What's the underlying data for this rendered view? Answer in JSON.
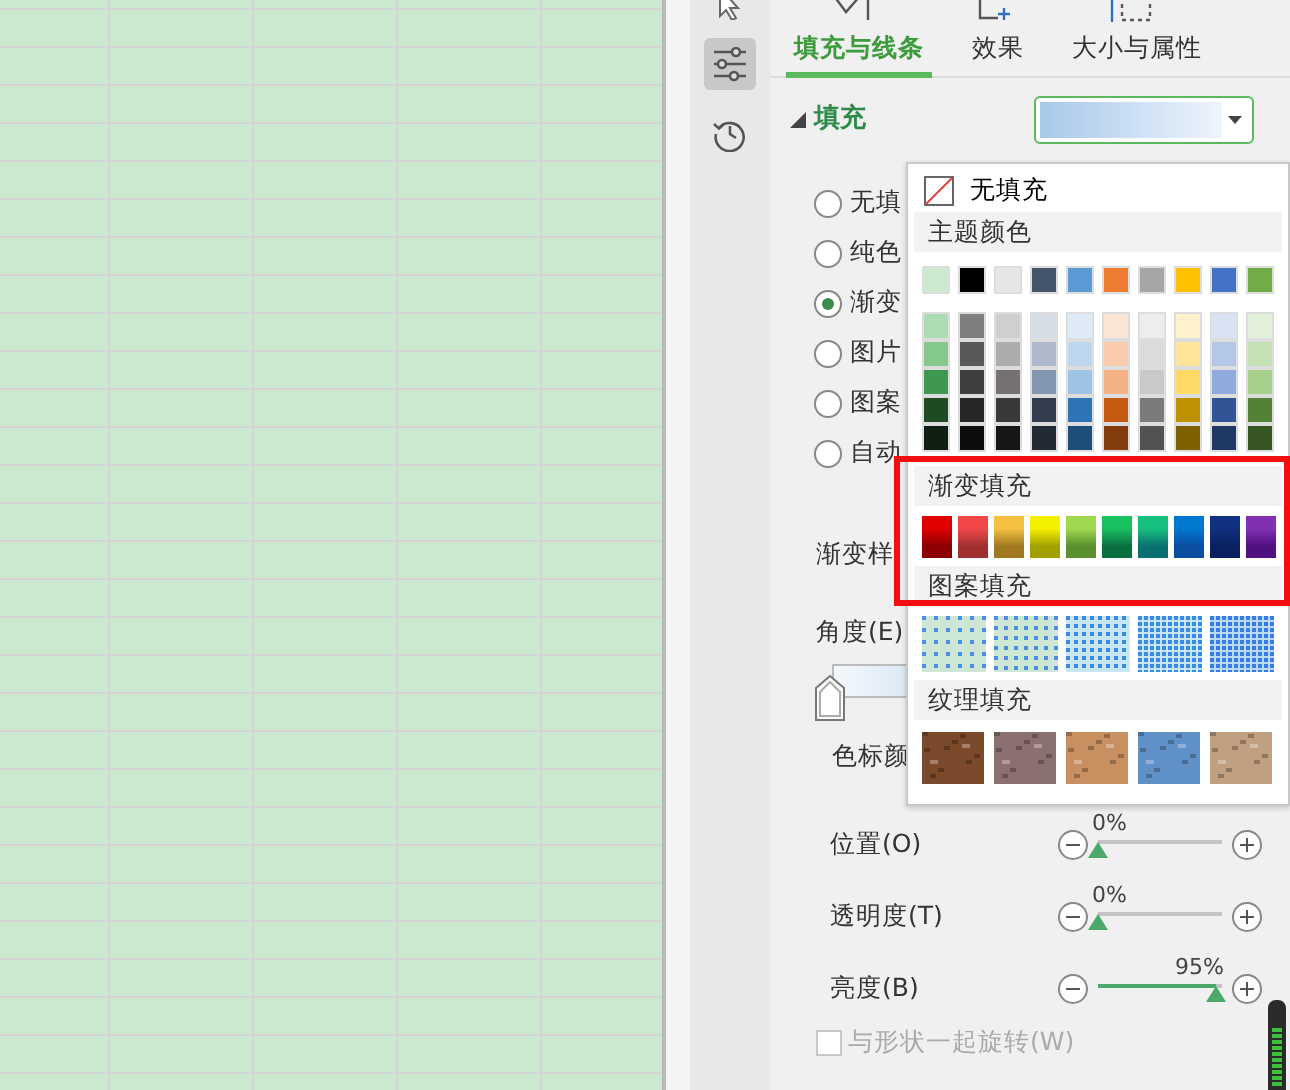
{
  "sidebar": {
    "items": [
      {
        "kind": "pointer",
        "selected": false
      },
      {
        "kind": "properties",
        "selected": true
      },
      {
        "kind": "history",
        "selected": false
      }
    ]
  },
  "tabs": [
    {
      "kind": "fill",
      "label": "填充与线条",
      "selected": true
    },
    {
      "kind": "effect",
      "label": "效果",
      "selected": false
    },
    {
      "kind": "size",
      "label": "大小与属性",
      "selected": false
    }
  ],
  "fill_section": {
    "title": "填充",
    "expanded": true,
    "options": [
      {
        "label": "无填",
        "selected": false
      },
      {
        "label": "纯色",
        "selected": false
      },
      {
        "label": "渐变",
        "selected": true
      },
      {
        "label": "图片",
        "selected": false
      },
      {
        "label": "图案",
        "selected": false
      },
      {
        "label": "自动",
        "selected": false
      }
    ]
  },
  "gradient_style_label": "渐变样",
  "angle_label": "角度(E)",
  "stop_color_label": "色标颜",
  "sliders": [
    {
      "label": "位置(O)",
      "level": 0,
      "reading": "0%"
    },
    {
      "label": "透明度(T)",
      "level": 0,
      "reading": "0%"
    },
    {
      "label": "亮度(B)",
      "level": 0.95,
      "reading": "95%"
    }
  ],
  "rotate_checkbox": {
    "label": "与形状一起旋转(W)",
    "checked": false,
    "disabled": true
  },
  "popup": {
    "no_fill": "无填充",
    "theme_title": "主题颜色",
    "theme_base": [
      {
        "color": "#cce8cf"
      },
      {
        "color": "#000000"
      },
      {
        "color": "#e7e6e6"
      },
      {
        "color": "#44546a"
      },
      {
        "color": "#5b9bd5"
      },
      {
        "color": "#ed7d31"
      },
      {
        "color": "#a5a5a5"
      },
      {
        "color": "#ffc000"
      },
      {
        "color": "#4472c4"
      },
      {
        "color": "#70ad47"
      }
    ],
    "theme_shades": [
      [
        {
          "color": "#acdcb4"
        },
        {
          "color": "#7f7f7f"
        },
        {
          "color": "#d0cece"
        },
        {
          "color": "#d6dce4"
        },
        {
          "color": "#deebf6"
        },
        {
          "color": "#fbe5d5"
        },
        {
          "color": "#ededed"
        },
        {
          "color": "#fff2cc"
        },
        {
          "color": "#dae3f3"
        },
        {
          "color": "#e2efd9"
        }
      ],
      [
        {
          "color": "#84c88c"
        },
        {
          "color": "#595959"
        },
        {
          "color": "#aeabab"
        },
        {
          "color": "#adb9ca"
        },
        {
          "color": "#bdd7ee"
        },
        {
          "color": "#f7cbac"
        },
        {
          "color": "#dbdbdb"
        },
        {
          "color": "#fee599"
        },
        {
          "color": "#b4c7e7"
        },
        {
          "color": "#c5e0b3"
        }
      ],
      [
        {
          "color": "#3f9850"
        },
        {
          "color": "#3f3f3f"
        },
        {
          "color": "#757171"
        },
        {
          "color": "#8497b0"
        },
        {
          "color": "#9dc3e6"
        },
        {
          "color": "#f4b183"
        },
        {
          "color": "#c9c9c9"
        },
        {
          "color": "#ffd965"
        },
        {
          "color": "#8faadc"
        },
        {
          "color": "#a8d08d"
        }
      ],
      [
        {
          "color": "#1e4a24"
        },
        {
          "color": "#262626"
        },
        {
          "color": "#3a3838"
        },
        {
          "color": "#333f4f"
        },
        {
          "color": "#2e75b5"
        },
        {
          "color": "#c55a11"
        },
        {
          "color": "#7b7b7b"
        },
        {
          "color": "#bf9000"
        },
        {
          "color": "#2f5597"
        },
        {
          "color": "#538135"
        }
      ],
      [
        {
          "color": "#0f1f12"
        },
        {
          "color": "#0d0d0d"
        },
        {
          "color": "#171616"
        },
        {
          "color": "#222a35"
        },
        {
          "color": "#1e4e79"
        },
        {
          "color": "#833c0b"
        },
        {
          "color": "#525252"
        },
        {
          "color": "#7f6000"
        },
        {
          "color": "#203864"
        },
        {
          "color": "#375623"
        }
      ]
    ],
    "gradient_title": "渐变填充",
    "gradients": [
      {
        "stops": [
          {
            "color": "#e00000"
          },
          {
            "color": "#8b0000"
          }
        ]
      },
      {
        "stops": [
          {
            "color": "#f04848"
          },
          {
            "color": "#a03030"
          }
        ]
      },
      {
        "stops": [
          {
            "color": "#f5c040"
          },
          {
            "color": "#a07820"
          }
        ]
      },
      {
        "stops": [
          {
            "color": "#f5f000"
          },
          {
            "color": "#a0a000"
          }
        ]
      },
      {
        "stops": [
          {
            "color": "#9ed84c"
          },
          {
            "color": "#5a9030"
          }
        ]
      },
      {
        "stops": [
          {
            "color": "#18c060"
          },
          {
            "color": "#0a7040"
          }
        ]
      },
      {
        "stops": [
          {
            "color": "#18c080"
          },
          {
            "color": "#087070"
          }
        ]
      },
      {
        "stops": [
          {
            "color": "#0078d0"
          },
          {
            "color": "#0a4ea0"
          }
        ]
      },
      {
        "stops": [
          {
            "color": "#103080"
          },
          {
            "color": "#0a2060"
          }
        ]
      },
      {
        "stops": [
          {
            "color": "#8030b0"
          },
          {
            "color": "#501080"
          }
        ]
      }
    ],
    "pattern_title": "图案填充",
    "patterns": [
      {
        "dot": {
          "color": "#4a90e0"
        },
        "ground": {
          "color": "#cce8d5"
        }
      },
      {
        "dot": {
          "color": "#4a90e0"
        },
        "ground": {
          "color": "#cce8d5"
        }
      },
      {
        "dot": {
          "color": "#3a8ae8"
        },
        "ground": {
          "color": "#c8e6f4"
        }
      },
      {
        "dot": {
          "color": "#3a8ae8"
        },
        "ground": {
          "color": "#c8e6f4"
        }
      },
      {
        "dot": {
          "color": "#3a7ae8"
        },
        "ground": {
          "color": "#b8daf4"
        }
      }
    ],
    "texture_title": "纹理填充",
    "textures": [
      {
        "color": "#7a4a2a"
      },
      {
        "color": "#8a7070"
      },
      {
        "color": "#c89060"
      },
      {
        "color": "#6090c8"
      },
      {
        "color": "#c0a080"
      }
    ]
  }
}
